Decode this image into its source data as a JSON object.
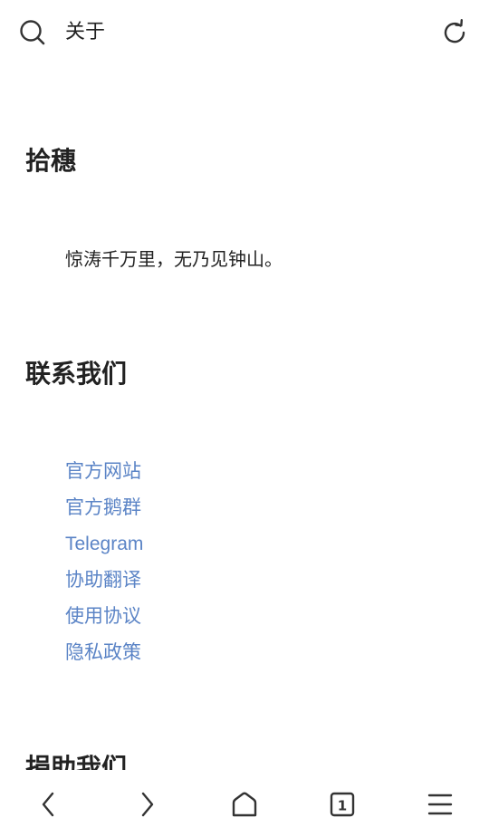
{
  "header": {
    "title": "关于",
    "search_icon": "search-icon",
    "refresh_icon": "refresh-icon"
  },
  "sections": {
    "about": {
      "title": "拾穗",
      "quote": "惊涛千万里，无乃见钟山。"
    },
    "contact": {
      "title": "联系我们",
      "links": [
        {
          "label": "官方网站"
        },
        {
          "label": "官方鹅群"
        },
        {
          "label": "Telegram"
        },
        {
          "label": "协助翻译"
        },
        {
          "label": "使用协议"
        },
        {
          "label": "隐私政策"
        }
      ]
    },
    "donate": {
      "title": "捐助我们"
    }
  },
  "bottom_nav": {
    "tab_count": "1",
    "icons": [
      "back-icon",
      "forward-icon",
      "home-icon",
      "tabs-icon",
      "menu-icon"
    ]
  },
  "colors": {
    "link": "#5b84c6",
    "text": "#222222",
    "background": "#ffffff"
  }
}
